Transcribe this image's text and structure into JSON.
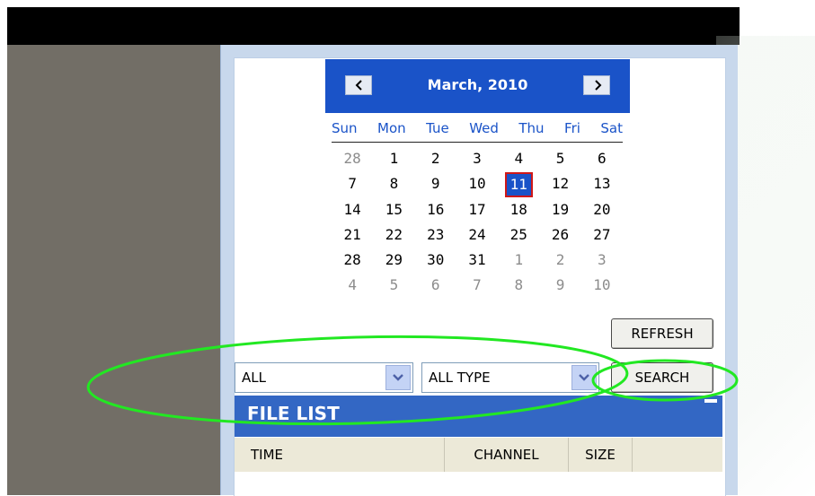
{
  "calendar": {
    "title": "March, 2010",
    "days_of_week": [
      "Sun",
      "Mon",
      "Tue",
      "Wed",
      "Thu",
      "Fri",
      "Sat"
    ],
    "weeks": [
      [
        {
          "d": "28",
          "other": true
        },
        {
          "d": "1"
        },
        {
          "d": "2"
        },
        {
          "d": "3"
        },
        {
          "d": "4"
        },
        {
          "d": "5"
        },
        {
          "d": "6"
        }
      ],
      [
        {
          "d": "7"
        },
        {
          "d": "8"
        },
        {
          "d": "9"
        },
        {
          "d": "10"
        },
        {
          "d": "11",
          "selected": true
        },
        {
          "d": "12"
        },
        {
          "d": "13"
        }
      ],
      [
        {
          "d": "14"
        },
        {
          "d": "15"
        },
        {
          "d": "16"
        },
        {
          "d": "17"
        },
        {
          "d": "18"
        },
        {
          "d": "19"
        },
        {
          "d": "20"
        }
      ],
      [
        {
          "d": "21"
        },
        {
          "d": "22"
        },
        {
          "d": "23"
        },
        {
          "d": "24"
        },
        {
          "d": "25"
        },
        {
          "d": "26"
        },
        {
          "d": "27"
        }
      ],
      [
        {
          "d": "28"
        },
        {
          "d": "29"
        },
        {
          "d": "30"
        },
        {
          "d": "31"
        },
        {
          "d": "1",
          "other": true
        },
        {
          "d": "2",
          "other": true
        },
        {
          "d": "3",
          "other": true
        }
      ],
      [
        {
          "d": "4",
          "other": true
        },
        {
          "d": "5",
          "other": true
        },
        {
          "d": "6",
          "other": true
        },
        {
          "d": "7",
          "other": true
        },
        {
          "d": "8",
          "other": true
        },
        {
          "d": "9",
          "other": true
        },
        {
          "d": "10",
          "other": true
        }
      ]
    ],
    "prev_icon": "chevron-left-icon",
    "next_icon": "chevron-right-icon"
  },
  "buttons": {
    "refresh": "REFRESH",
    "search": "SEARCH"
  },
  "filters": {
    "channel_value": "ALL",
    "type_value": "ALL TYPE"
  },
  "file_list": {
    "title": "FILE LIST",
    "columns": [
      "TIME",
      "CHANNEL",
      "SIZE"
    ]
  },
  "colors": {
    "calendar_header": "#1a53c8",
    "selected_day_border": "#d01818",
    "file_list_header": "#3367c4",
    "annotation": "#22e822"
  }
}
